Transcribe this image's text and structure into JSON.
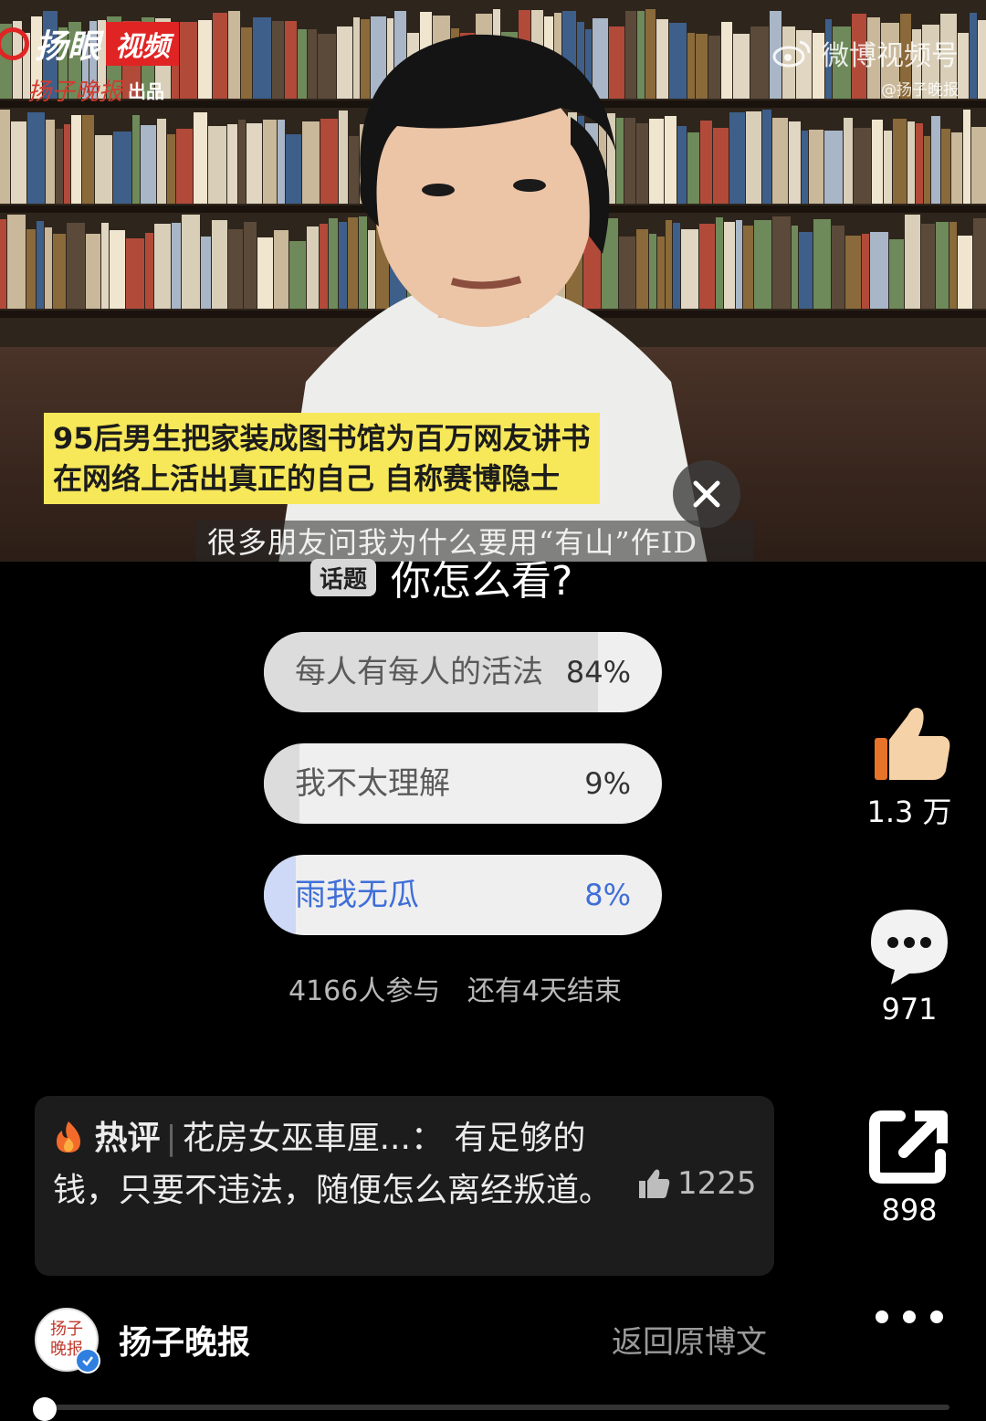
{
  "video": {
    "logo_text": "扬眼",
    "logo_badge": "视频",
    "logo_sub_script": "扬子晚报",
    "logo_sub_text": "出品",
    "watermark_name": "微博视频号",
    "watermark_handle": "@扬子晚报",
    "caption_line1": "95后男生把家装成图书馆为百万网友讲书",
    "caption_line2": "在网络上活出真正的自己 自称赛博隐士",
    "subtitle": "很多朋友问我为什么要用“有山”作ID"
  },
  "topic": {
    "tag": "话题",
    "title": "你怎么看?"
  },
  "poll": {
    "options": [
      {
        "label": "每人有每人的活法",
        "percent_text": "84%",
        "fill": 0.84,
        "selected": false
      },
      {
        "label": "我不太理解",
        "percent_text": "9%",
        "fill": 0.09,
        "selected": false
      },
      {
        "label": "雨我无瓜",
        "percent_text": "8%",
        "fill": 0.08,
        "selected": true
      }
    ],
    "participants": "4166人参与",
    "remaining": "还有4天结束"
  },
  "actions": {
    "likes": "1.3 万",
    "comments": "971",
    "shares": "898"
  },
  "hot_comment": {
    "tag": "热评",
    "author": "花房女巫車厘...",
    "text": "有足够的钱，只要不违法，随便怎么离经叛道。",
    "likes": "1225"
  },
  "author": {
    "avatar_text": "扬子晚报",
    "name": "扬子晚报",
    "back_link": "返回原博文"
  },
  "colors": {
    "accent_blue": "#3f6fd8",
    "selected_fill": "#cdd9f6",
    "logo_red": "#e02424",
    "caption_yellow": "#f7e85a"
  },
  "icons": [
    "close-icon",
    "thumbs-up-icon",
    "comment-bubble-icon",
    "share-icon",
    "flame-icon",
    "more-dots-icon",
    "verified-icon"
  ]
}
